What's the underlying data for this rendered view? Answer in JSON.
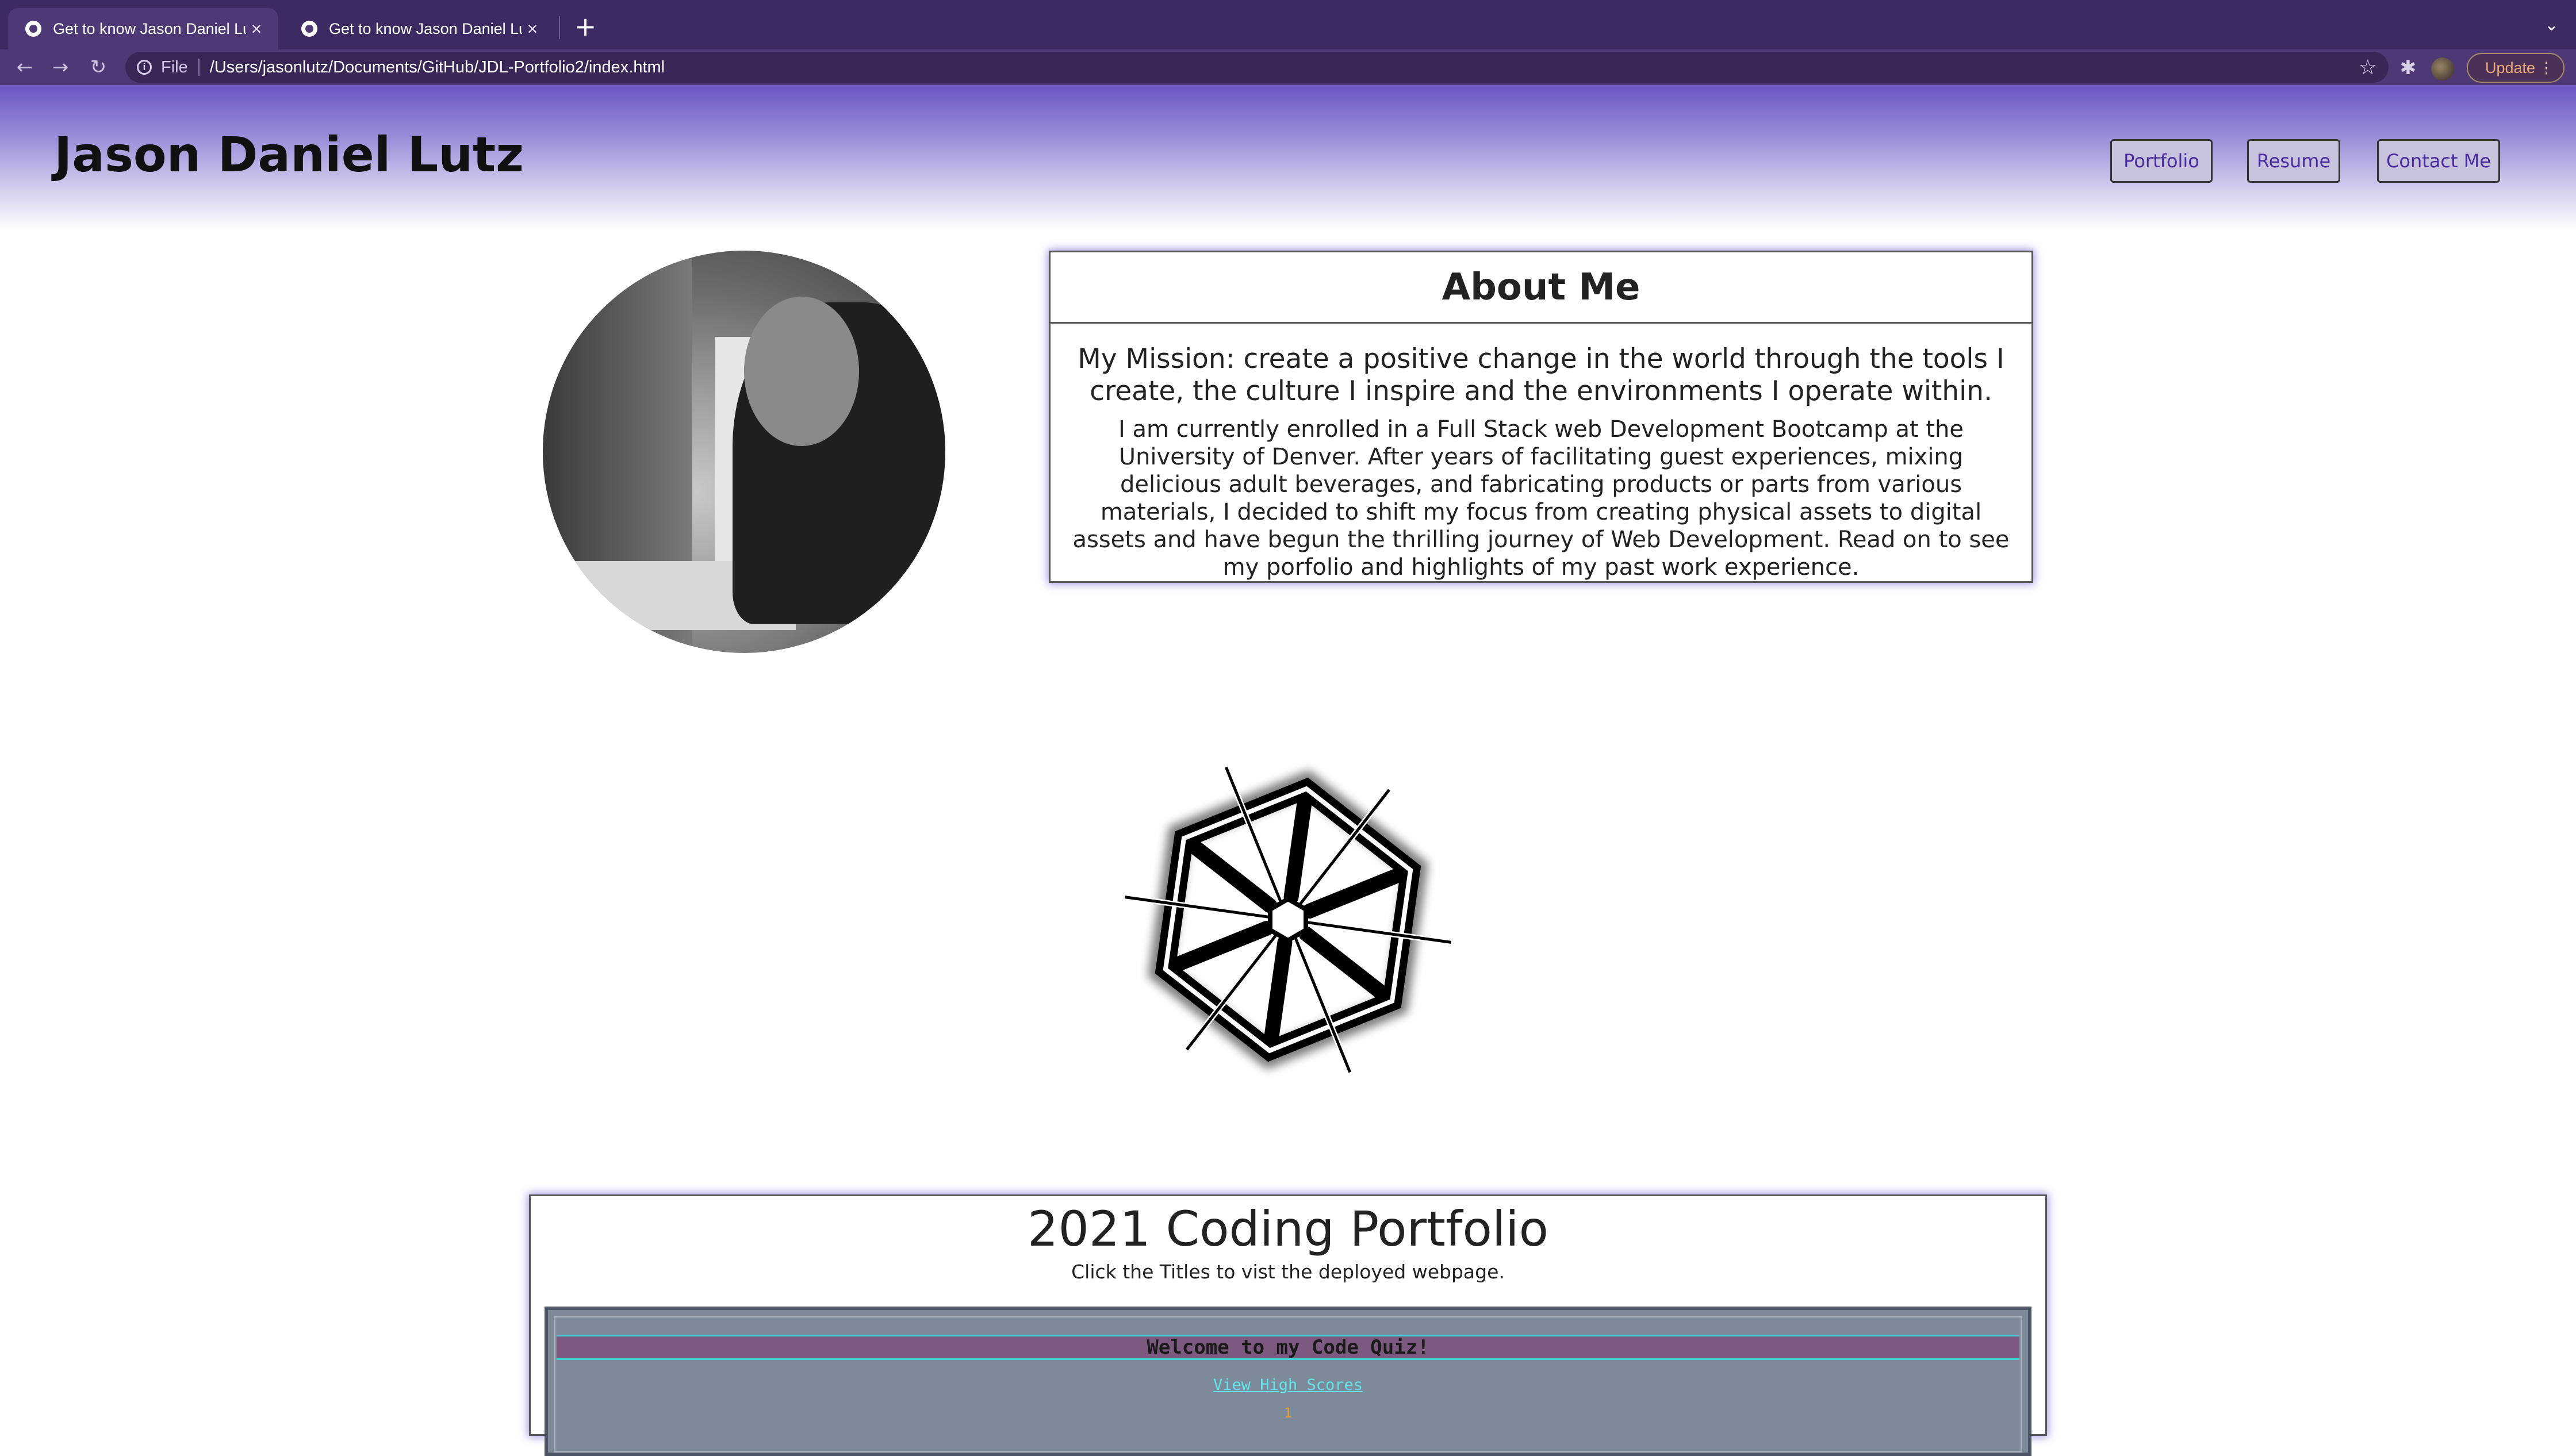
{
  "browser": {
    "tabs": [
      {
        "title": "Get to know Jason Daniel Lutz",
        "active": true
      },
      {
        "title": "Get to know Jason Daniel Lutz",
        "active": false
      }
    ],
    "new_tab_glyph": "+",
    "close_glyph": "×",
    "tab_menu_glyph": "⌄",
    "nav": {
      "back_glyph": "←",
      "forward_glyph": "→",
      "reload_glyph": "↻"
    },
    "address": {
      "info_glyph": "i",
      "scheme": "File",
      "url": "/Users/jasonlutz/Documents/GitHub/JDL-Portfolio2/index.html",
      "star_glyph": "☆"
    },
    "extensions_glyph": "✱",
    "update_label": "Update",
    "menu_glyph": "⋮"
  },
  "header": {
    "title": "Jason Daniel Lutz",
    "nav": [
      {
        "label": "Portfolio"
      },
      {
        "label": "Resume"
      },
      {
        "label": "Contact Me"
      }
    ]
  },
  "about": {
    "heading": "About Me",
    "mission": "My Mission: create a positive change in the world through the tools I create, the culture I inspire and the environments I operate within.",
    "bio": "I am currently enrolled in a Full Stack web Development Bootcamp at the University of Denver. After years of facilitating guest experiences, mixing delicious adult beverages, and fabricating products or parts from various materials, I decided to shift my focus from creating physical assets to digital assets and have begun the thrilling journey of Web Development. Read on to see my porfolio and highlights of my past work experience."
  },
  "portfolio": {
    "title": "2021 Coding Portfolio",
    "subtitle": "Click the Titles to vist the deployed webpage.",
    "project_preview": {
      "banner": "Welcome to my Code Quiz!",
      "link": "View High Scores",
      "timer": "1"
    }
  },
  "colors": {
    "accent": "#4a2aa0",
    "chrome": "#4e3976",
    "quiz_cyan": "#5fe6ea",
    "quiz_banner": "#7c5a80"
  }
}
